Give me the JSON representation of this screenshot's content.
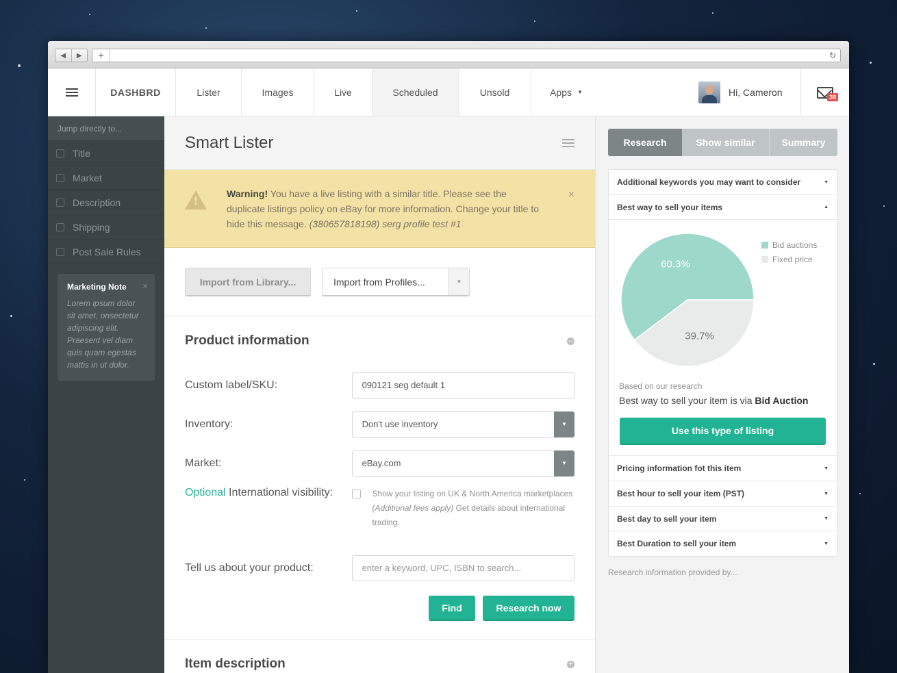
{
  "browser": {
    "back": "◀",
    "forward": "▶",
    "new_tab": "+",
    "reload": "↻"
  },
  "topnav": {
    "brand": "DASHBRD",
    "tabs": [
      "Lister",
      "Images",
      "Live",
      "Scheduled",
      "Unsold",
      "Apps"
    ],
    "active_tab": "Scheduled",
    "greeting": "Hi, Cameron",
    "mail_count": "38"
  },
  "sidebar": {
    "jump_label": "Jump directly to...",
    "items": [
      "Title",
      "Market",
      "Description",
      "Shipping",
      "Post Sale Rules"
    ],
    "note": {
      "title": "Marketing Note",
      "close": "×",
      "text": "Lorem ipsum dolor sit amet, onsectetur adipiscing elit. Praesent vel diam quis quam egestas mattis in ut dolor."
    }
  },
  "main": {
    "title": "Smart Lister",
    "warning": {
      "strong": "Warning!",
      "text": " You have a live listing with a similar title. Please see the duplicate listings policy on eBay for more information. Change your title to hide this message. ",
      "italic": "(380657818198) serg profile test #1",
      "close": "×"
    },
    "import_library": "Import from Library...",
    "import_profiles": "Import from Profiles...",
    "product_section": {
      "title": "Product information",
      "sku_label": "Custom label/SKU:",
      "sku_value": "090121 seg default 1",
      "inventory_label": "Inventory:",
      "inventory_value": "Don't use inventory",
      "market_label": "Market:",
      "market_value": "eBay.com",
      "intl_optional": "Optional",
      "intl_label": " International visibility:",
      "intl_text_1": "Show your listing on UK & North America marketplaces ",
      "intl_text_italic": "(Additional fees apply)",
      "intl_text_2": " Get details about international trading.",
      "tell_label": "Tell us about your product:",
      "tell_placeholder": "enter a keyword, UPC, ISBN to search...",
      "find_button": "Find",
      "research_button": "Research now"
    },
    "item_description_title": "Item description"
  },
  "right": {
    "tabs": [
      "Research",
      "Show similar",
      "Summary"
    ],
    "accordion": {
      "keywords": "Additional keywords you may want to consider",
      "best_way": "Best way to sell your items",
      "pricing": "Pricing information fot this item",
      "best_hour": "Best hour to sell your item (PST)",
      "best_day": "Best day to sell your item",
      "best_duration": "Best Duration to sell your item"
    },
    "based_on": "Based on our research",
    "best_prefix": "Best way to sell your item is via ",
    "best_method": "Bid Auction",
    "use_button": "Use this type of listing",
    "provided_by": "Research information provided by..."
  },
  "colors": {
    "accent": "#22b394",
    "bid": "#9ed8ca",
    "fixed": "#e9eaea"
  },
  "chart_data": {
    "type": "pie",
    "categories": [
      "Bid auctions",
      "Fixed price"
    ],
    "values": [
      60.3,
      39.7
    ],
    "data_labels": [
      "60.3%",
      "39.7%"
    ]
  }
}
